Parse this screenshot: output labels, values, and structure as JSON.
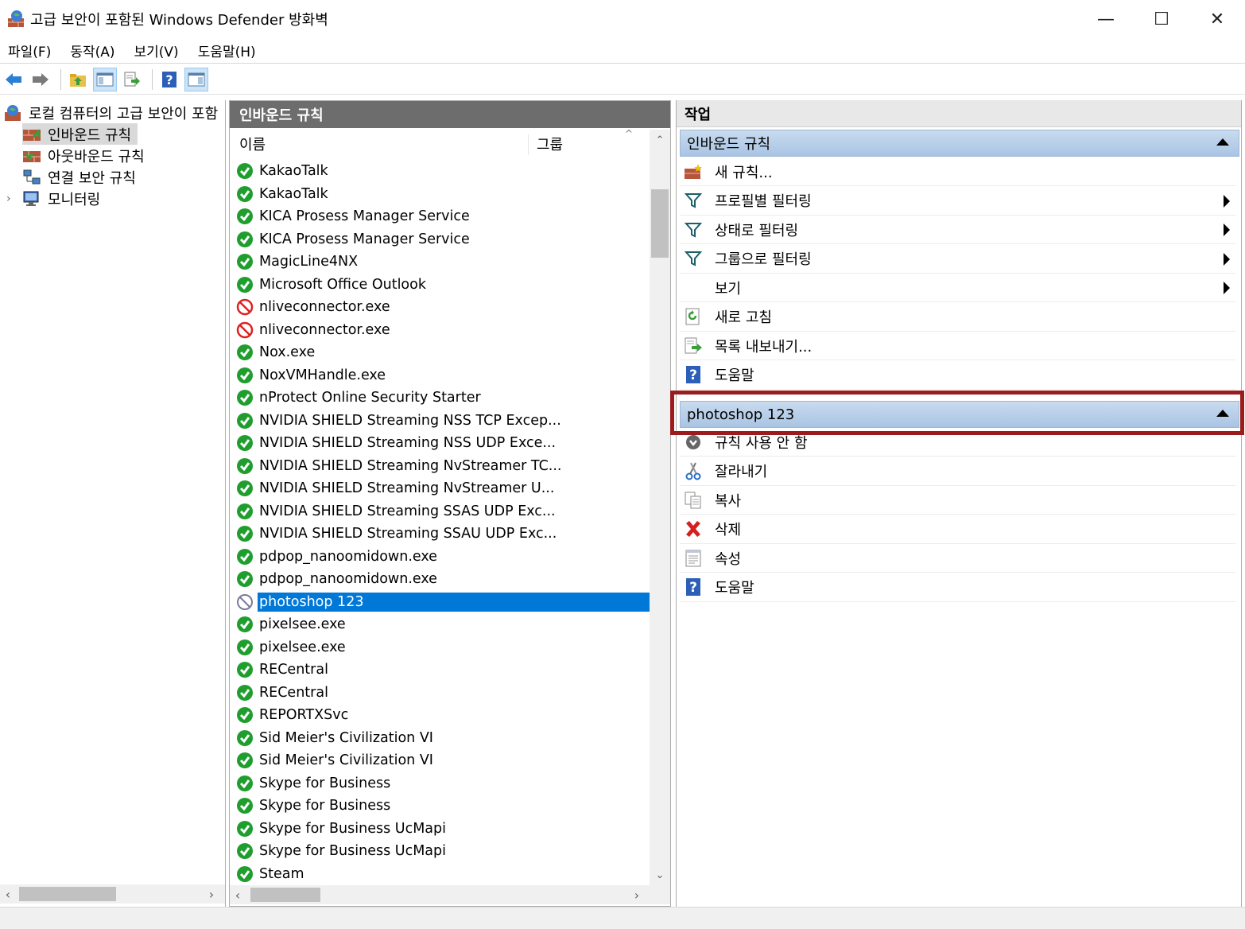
{
  "window": {
    "title": "고급 보안이 포함된 Windows Defender 방화벽",
    "minimize": "—",
    "maximize": "☐",
    "close": "✕"
  },
  "menu": [
    "파일(F)",
    "동작(A)",
    "보기(V)",
    "도움말(H)"
  ],
  "tree": {
    "root": "로컬 컴퓨터의 고급 보안이 포함",
    "items": [
      {
        "label": "인바운드 규칙",
        "icon": "inbound-rules-icon",
        "selected": true
      },
      {
        "label": "아웃바운드 규칙",
        "icon": "outbound-rules-icon",
        "selected": false
      },
      {
        "label": "연결 보안 규칙",
        "icon": "connection-security-icon",
        "selected": false
      },
      {
        "label": "모니터링",
        "icon": "monitoring-icon",
        "selected": false
      }
    ],
    "expander": "›"
  },
  "middle": {
    "header": "인바운드 규칙",
    "columns": {
      "name": "이름",
      "group": "그룹"
    },
    "rules": [
      {
        "name": "KakaoTalk",
        "status": "allow"
      },
      {
        "name": "KakaoTalk",
        "status": "allow"
      },
      {
        "name": "KICA Prosess Manager Service",
        "status": "allow"
      },
      {
        "name": "KICA Prosess Manager Service",
        "status": "allow"
      },
      {
        "name": "MagicLine4NX",
        "status": "allow"
      },
      {
        "name": "Microsoft Office Outlook",
        "status": "allow"
      },
      {
        "name": "nliveconnector.exe",
        "status": "block"
      },
      {
        "name": "nliveconnector.exe",
        "status": "block"
      },
      {
        "name": "Nox.exe",
        "status": "allow"
      },
      {
        "name": "NoxVMHandle.exe",
        "status": "allow"
      },
      {
        "name": "nProtect Online Security Starter",
        "status": "allow"
      },
      {
        "name": "NVIDIA SHIELD Streaming NSS TCP Excep...",
        "status": "allow"
      },
      {
        "name": "NVIDIA SHIELD Streaming NSS UDP Exce...",
        "status": "allow"
      },
      {
        "name": "NVIDIA SHIELD Streaming NvStreamer TC...",
        "status": "allow"
      },
      {
        "name": "NVIDIA SHIELD Streaming NvStreamer U...",
        "status": "allow"
      },
      {
        "name": "NVIDIA SHIELD Streaming SSAS UDP Exc...",
        "status": "allow"
      },
      {
        "name": "NVIDIA SHIELD Streaming SSAU UDP Exc...",
        "status": "allow"
      },
      {
        "name": "pdpop_nanoomidown.exe",
        "status": "allow"
      },
      {
        "name": "pdpop_nanoomidown.exe",
        "status": "allow"
      },
      {
        "name": "photoshop 123",
        "status": "disabled",
        "selected": true
      },
      {
        "name": "pixelsee.exe",
        "status": "allow"
      },
      {
        "name": "pixelsee.exe",
        "status": "allow"
      },
      {
        "name": "RECentral",
        "status": "allow"
      },
      {
        "name": "RECentral",
        "status": "allow"
      },
      {
        "name": "REPORTXSvc",
        "status": "allow"
      },
      {
        "name": "Sid Meier's Civilization VI",
        "status": "allow"
      },
      {
        "name": "Sid Meier's Civilization VI",
        "status": "allow"
      },
      {
        "name": "Skype for Business",
        "status": "allow"
      },
      {
        "name": "Skype for Business",
        "status": "allow"
      },
      {
        "name": "Skype for Business UcMapi",
        "status": "allow"
      },
      {
        "name": "Skype for Business UcMapi",
        "status": "allow"
      },
      {
        "name": "Steam",
        "status": "allow"
      }
    ]
  },
  "actions": {
    "header": "작업",
    "section1": {
      "title": "인바운드 규칙",
      "items": [
        {
          "label": "새 규칙...",
          "icon": "new-rule-icon",
          "submenu": false
        },
        {
          "label": "프로필별 필터링",
          "icon": "filter-icon",
          "submenu": true
        },
        {
          "label": "상태로 필터링",
          "icon": "filter-icon",
          "submenu": true
        },
        {
          "label": "그룹으로 필터링",
          "icon": "filter-icon",
          "submenu": true
        },
        {
          "label": "보기",
          "icon": "",
          "submenu": true
        },
        {
          "label": "새로 고침",
          "icon": "refresh-icon",
          "submenu": false
        },
        {
          "label": "목록 내보내기...",
          "icon": "export-list-icon",
          "submenu": false
        },
        {
          "label": "도움말",
          "icon": "help-icon",
          "submenu": false
        }
      ]
    },
    "section2": {
      "title": "photoshop 123",
      "items": [
        {
          "label": "규칙 사용 안 함",
          "icon": "disable-rule-icon"
        },
        {
          "label": "잘라내기",
          "icon": "cut-icon"
        },
        {
          "label": "복사",
          "icon": "copy-icon"
        },
        {
          "label": "삭제",
          "icon": "delete-icon"
        },
        {
          "label": "속성",
          "icon": "properties-icon"
        },
        {
          "label": "도움말",
          "icon": "help-icon"
        }
      ]
    }
  },
  "colors": {
    "selection": "#0078d7",
    "allow": "#1f9e2e",
    "block": "#e02020",
    "highlight_border": "#9b1c1c",
    "section_header": "#b7cde8"
  }
}
